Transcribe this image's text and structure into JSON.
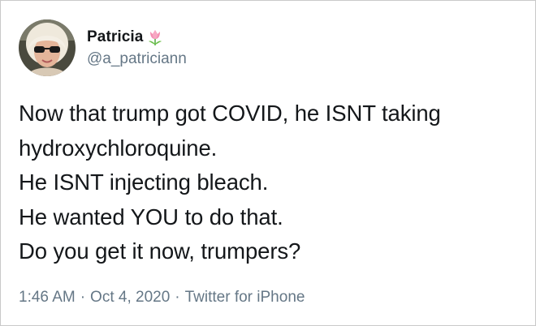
{
  "tweet": {
    "author": {
      "display_name": "Patricia",
      "handle": "@a_patriciann",
      "name_emoji_icon": "tulip-icon",
      "avatar_icon": "profile-photo-sunglasses"
    },
    "lines": [
      "Now that trump got COVID, he ISNT taking",
      "hydroxychloroquine.",
      "He ISNT injecting bleach.",
      "He wanted YOU to do that.",
      "Do you get it now, trumpers?"
    ],
    "meta": {
      "time": "1:46 AM",
      "separator": "·",
      "date": "Oct 4, 2020",
      "source": "Twitter for iPhone"
    }
  },
  "colors": {
    "text": "#14171a",
    "secondary": "#657786",
    "border": "#c9c9c9",
    "tulip": "#f48fb1"
  }
}
